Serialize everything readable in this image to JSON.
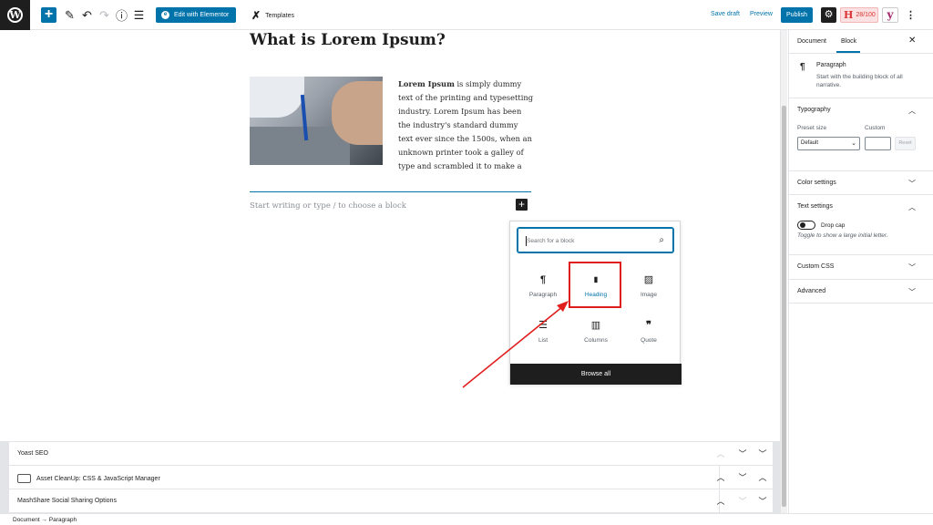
{
  "topbar": {
    "elementor_label": "Edit with Elementor",
    "templates_label": "Templates",
    "save_draft_label": "Save draft",
    "preview_label": "Preview",
    "publish_label": "Publish",
    "seo_score": "28/100"
  },
  "post": {
    "title": "What is Lorem Ipsum?",
    "paragraph_bold": "Lorem Ipsum",
    "paragraph_rest": " is simply dummy text of the printing and typesetting industry. Lorem Ipsum has been the industry's standard dummy text ever since the 1500s, when an unknown printer took a galley of type and scrambled it to make a",
    "new_block_placeholder": "Start writing or type / to choose a block"
  },
  "inserter": {
    "search_placeholder": "Search for a block",
    "blocks": [
      {
        "label": "Paragraph",
        "icon": "paragraph-icon",
        "glyph": "¶"
      },
      {
        "label": "Heading",
        "icon": "heading-bookmark-icon",
        "glyph": "⬛"
      },
      {
        "label": "Image",
        "icon": "image-icon",
        "glyph": "▨"
      },
      {
        "label": "List",
        "icon": "list-icon",
        "glyph": "☰"
      },
      {
        "label": "Columns",
        "icon": "columns-icon",
        "glyph": "▥"
      },
      {
        "label": "Quote",
        "icon": "quote-icon",
        "glyph": "❞"
      }
    ],
    "browse_all_label": "Browse all",
    "highlight_color": "#e01e1e"
  },
  "metaboxes": [
    {
      "label": "Yoast SEO"
    },
    {
      "label": "Asset CleanUp: CSS & JavaScript Manager"
    },
    {
      "label": "MashShare Social Sharing Options"
    }
  ],
  "sidebar": {
    "tab_document": "Document",
    "tab_block": "Block",
    "block_card_title": "Paragraph",
    "block_card_desc": "Start with the building block of all narrative.",
    "typography_label": "Typography",
    "preset_size_label": "Preset size",
    "custom_label": "Custom",
    "preset_value": "Default",
    "reset_label": "Reset",
    "color_settings_label": "Color settings",
    "text_settings_label": "Text settings",
    "drop_cap_label": "Drop cap",
    "drop_cap_help": "Toggle to show a large initial letter.",
    "custom_css_label": "Custom CSS",
    "advanced_label": "Advanced"
  },
  "footer": {
    "breadcrumb": "Document → Paragraph"
  },
  "colors": {
    "accent": "#0073aa",
    "dark": "#1e1e1e",
    "annotation_red": "#e01e1e"
  }
}
